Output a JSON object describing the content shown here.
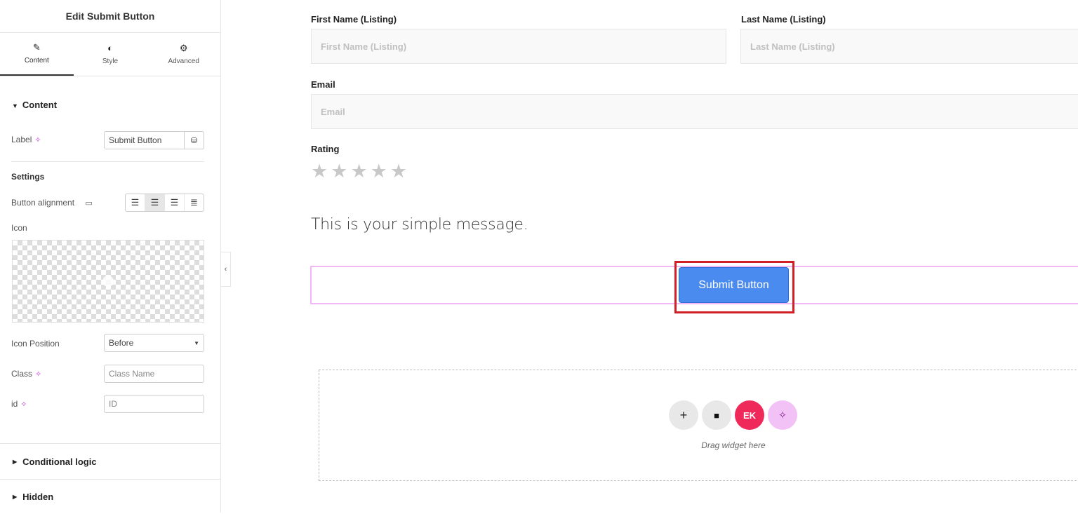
{
  "panel": {
    "title": "Edit Submit Button",
    "tabs": [
      {
        "label": "Content",
        "icon": "pencil-icon",
        "glyph": "✎"
      },
      {
        "label": "Style",
        "icon": "contrast-icon",
        "glyph": "◐"
      },
      {
        "label": "Advanced",
        "icon": "gear-icon",
        "glyph": "⚙"
      }
    ],
    "section_content": "Content",
    "label_field": {
      "label": "Label",
      "value": "Submit Button"
    },
    "settings_heading": "Settings",
    "button_alignment_label": "Button alignment",
    "icon_label": "Icon",
    "icon_position": {
      "label": "Icon Position",
      "value": "Before"
    },
    "class_field": {
      "label": "Class",
      "placeholder": "Class Name"
    },
    "id_field": {
      "label": "id",
      "placeholder": "ID"
    },
    "conditional_logic": "Conditional logic",
    "hidden": "Hidden"
  },
  "form": {
    "first_name": {
      "label": "First Name (Listing)",
      "placeholder": "First Name (Listing)"
    },
    "last_name": {
      "label": "Last Name (Listing)",
      "placeholder": "Last Name (Listing)"
    },
    "email": {
      "label": "Email",
      "placeholder": "Email"
    },
    "rating": {
      "label": "Rating",
      "value": 0,
      "max": 5
    },
    "message": "This is your simple message.",
    "submit_label": "Submit Button"
  },
  "dropzone": {
    "text": "Drag widget here",
    "buttons": [
      {
        "icon": "plus-icon",
        "glyph": "+"
      },
      {
        "icon": "folder-icon",
        "glyph": "■"
      },
      {
        "icon": "elementskit-icon",
        "glyph": "EK"
      },
      {
        "icon": "ai-sparkle-icon",
        "glyph": "✧"
      }
    ]
  },
  "colors": {
    "accent_submit": "#4a8bef",
    "highlight": "#d01f26",
    "ai_pink": "#c43cd9",
    "ek_red": "#ef2a5a"
  }
}
